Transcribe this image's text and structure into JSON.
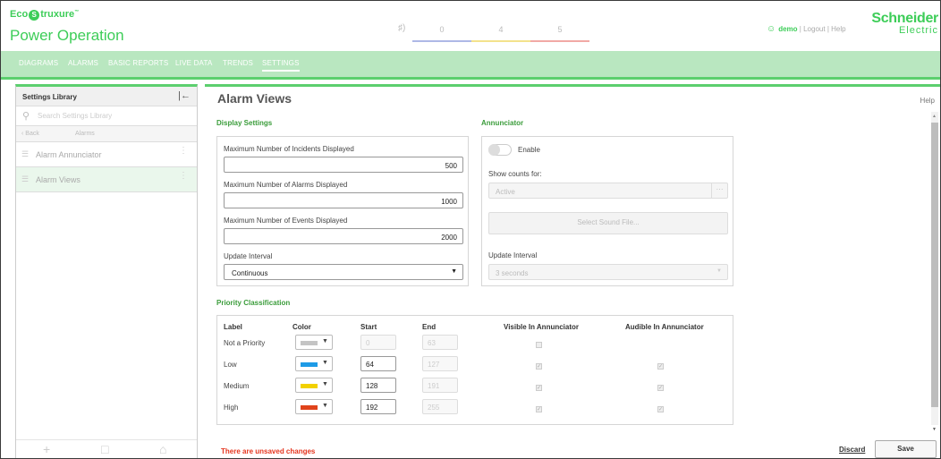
{
  "header": {
    "brand_eco": "Eco",
    "brand_struxure": "truxure",
    "brand_tm": "™",
    "app_title": "Power Operation",
    "speaker_icon": "speaker-icon",
    "alarm_counts": [
      {
        "value": "0",
        "color": "#aeb8e6"
      },
      {
        "value": "4",
        "color": "#f3e28c"
      },
      {
        "value": "5",
        "color": "#f1a9a5"
      }
    ],
    "user_name": "demo",
    "separator": "|",
    "logout_label": "Logout",
    "help_label": "Help",
    "vendor_line1": "Schneider",
    "vendor_line2": "Electric"
  },
  "nav": {
    "items": [
      {
        "label": "DIAGRAMS"
      },
      {
        "label": "ALARMS"
      },
      {
        "label": "BASIC REPORTS"
      },
      {
        "label": "LIVE DATA"
      },
      {
        "label": "TRENDS"
      },
      {
        "label": "SETTINGS"
      }
    ],
    "active": "SETTINGS"
  },
  "sidebar": {
    "title": "Settings Library",
    "search_placeholder": "Search Settings Library",
    "back_label": "Back",
    "crumb_label": "Alarms",
    "items": [
      {
        "label": "Alarm Annunciator",
        "selected": false
      },
      {
        "label": "Alarm Views",
        "selected": true
      }
    ]
  },
  "main": {
    "title": "Alarm Views",
    "help_label": "Help",
    "display_settings": {
      "title": "Display Settings",
      "incidents_label": "Maximum Number of Incidents Displayed",
      "incidents_value": "500",
      "alarms_label": "Maximum Number of Alarms Displayed",
      "alarms_value": "1000",
      "events_label": "Maximum Number of Events Displayed",
      "events_value": "2000",
      "update_label": "Update Interval",
      "update_value": "Continuous"
    },
    "annunciator": {
      "title": "Annunciator",
      "enable_label": "Enable",
      "enabled": false,
      "show_counts_label": "Show counts for:",
      "show_counts_value": "Active",
      "browse_label": "···",
      "sound_button_label": "Select Sound File...",
      "update_label": "Update Interval",
      "update_value": "3 seconds"
    },
    "priority": {
      "title": "Priority Classification",
      "headers": {
        "label": "Label",
        "color": "Color",
        "start": "Start",
        "end": "End",
        "visible": "Visible In Annunciator",
        "audible": "Audible In Annunciator"
      },
      "rows": [
        {
          "label": "Not a Priority",
          "color": "#c4c4c4",
          "start": "0",
          "end": "63",
          "visible": false,
          "audible": null
        },
        {
          "label": "Low",
          "color": "#1e9be6",
          "start": "64",
          "end": "127",
          "visible": true,
          "audible": true
        },
        {
          "label": "Medium",
          "color": "#f2d100",
          "start": "128",
          "end": "191",
          "visible": true,
          "audible": true
        },
        {
          "label": "High",
          "color": "#e0431b",
          "start": "192",
          "end": "255",
          "visible": true,
          "audible": true
        }
      ]
    },
    "footer": {
      "unsaved_message": "There are unsaved changes",
      "discard_label": "Discard",
      "save_label": "Save"
    }
  }
}
